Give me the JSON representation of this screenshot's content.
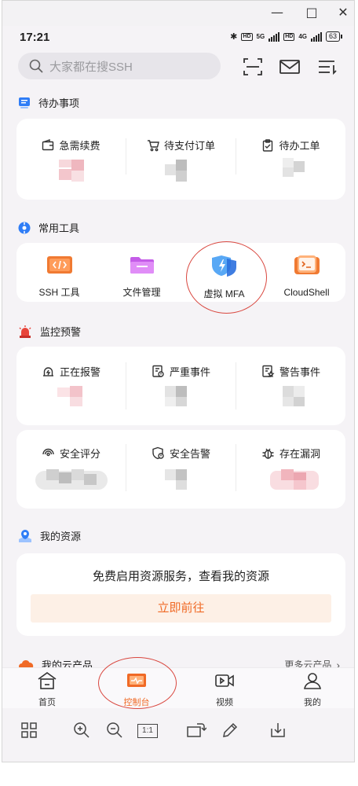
{
  "window": {
    "minimize_icon": "minimize-icon",
    "maximize_icon": "maximize-icon",
    "close_icon": "close-icon"
  },
  "status": {
    "time": "17:21",
    "network1": "5G",
    "network2": "4G",
    "hd": "HD",
    "battery": "63"
  },
  "search": {
    "placeholder": "大家都在搜SSH"
  },
  "todo": {
    "title": "待办事项",
    "items": [
      {
        "label": "急需续费",
        "icon": "wallet-icon"
      },
      {
        "label": "待支付订单",
        "icon": "cart-icon"
      },
      {
        "label": "待办工单",
        "icon": "clipboard-icon"
      }
    ]
  },
  "tools": {
    "title": "常用工具",
    "items": [
      {
        "label": "SSH 工具",
        "icon": "ssh-terminal-icon"
      },
      {
        "label": "文件管理",
        "icon": "folder-icon"
      },
      {
        "label": "虚拟 MFA",
        "icon": "mfa-shield-icon"
      },
      {
        "label": "CloudShell",
        "icon": "cloudshell-icon"
      }
    ]
  },
  "monitor": {
    "title": "监控预警",
    "row1": [
      {
        "label": "正在报警",
        "icon": "alarm-icon"
      },
      {
        "label": "严重事件",
        "icon": "critical-event-icon"
      },
      {
        "label": "警告事件",
        "icon": "warning-event-icon"
      }
    ],
    "row2": [
      {
        "label": "安全评分",
        "icon": "security-score-icon"
      },
      {
        "label": "安全告警",
        "icon": "security-alert-icon"
      },
      {
        "label": "存在漏洞",
        "icon": "bug-icon"
      }
    ]
  },
  "resources": {
    "title": "我的资源",
    "message": "免费启用资源服务，查看我的资源",
    "button": "立即前往"
  },
  "cloud": {
    "title": "我的云产品",
    "more": "更多云产品"
  },
  "nav": {
    "items": [
      {
        "label": "首页",
        "icon": "home-icon"
      },
      {
        "label": "控制台",
        "icon": "console-icon"
      },
      {
        "label": "视频",
        "icon": "video-icon"
      },
      {
        "label": "我的",
        "icon": "profile-icon"
      }
    ]
  },
  "toolbar": {
    "zoom_reset": "1:1"
  },
  "colors": {
    "accent": "#f06a26",
    "annotation": "#d9473f",
    "card": "#ffffff",
    "background": "#f5f3f6"
  }
}
